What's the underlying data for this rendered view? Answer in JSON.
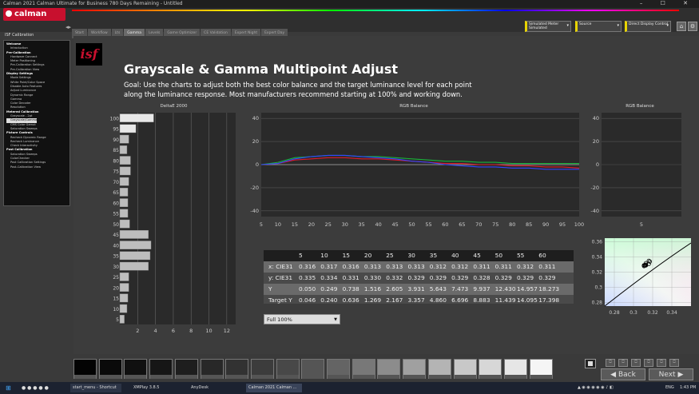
{
  "window": {
    "title": "Calman 2021 Calman Ultimate for Business 780 Days Remaining - Untitled",
    "controls": "–  ☐  ✕"
  },
  "app": {
    "logo": "calman"
  },
  "tabs": [
    "Start",
    "Workflow",
    "Lts",
    "Gamma",
    "Levels",
    "Game Optimizer",
    "CE Validation",
    "Expert Night",
    "Expert Day"
  ],
  "devices": [
    {
      "label": "Simulated Meter",
      "sub": "Simulated"
    },
    {
      "label": "Source",
      "sub": ""
    },
    {
      "label": "Direct Display Control",
      "sub": ""
    }
  ],
  "sidebar": {
    "heading": "ISF Calibration",
    "items": [
      {
        "t": "Welcome",
        "k": "sec"
      },
      {
        "t": "Introduction",
        "k": "it"
      },
      {
        "t": "Pre-Calibration",
        "k": "sec"
      },
      {
        "t": "Hardware Connect",
        "k": "it"
      },
      {
        "t": "Meter Positioning",
        "k": "it"
      },
      {
        "t": "Pre-Calibration Settings",
        "k": "it"
      },
      {
        "t": "Pre-Calibration View",
        "k": "it"
      },
      {
        "t": "Display Settings",
        "k": "sec"
      },
      {
        "t": "Mode Settings",
        "k": "it"
      },
      {
        "t": "White Point/Color Space",
        "k": "it"
      },
      {
        "t": "Disable Auto Features",
        "k": "it"
      },
      {
        "t": "Adjust Luminance",
        "k": "it"
      },
      {
        "t": "Dynamic Range",
        "k": "it"
      },
      {
        "t": "Gamma",
        "k": "it"
      },
      {
        "t": "Color Decoder",
        "k": "it"
      },
      {
        "t": "Resolution",
        "k": "it"
      },
      {
        "t": "Metered Calibration",
        "k": "sec"
      },
      {
        "t": "Grayscale - 2pt",
        "k": "it"
      },
      {
        "t": "Grayscale/Gamma",
        "k": "sel"
      },
      {
        "t": "CMS Color Gamut",
        "k": "it"
      },
      {
        "t": "Saturation Sweeps",
        "k": "it"
      },
      {
        "t": "Picture Controls",
        "k": "sec"
      },
      {
        "t": "Recheck Dynamic Range",
        "k": "it"
      },
      {
        "t": "Recheck Luminance",
        "k": "it"
      },
      {
        "t": "Check Interactivity",
        "k": "it"
      },
      {
        "t": "Post Calibration",
        "k": "sec"
      },
      {
        "t": "Saturation Sweeps",
        "k": "it"
      },
      {
        "t": "ColorChecker",
        "k": "it"
      },
      {
        "t": "Post Calibration Settings",
        "k": "it"
      },
      {
        "t": "Post-Calibration View",
        "k": "it"
      }
    ]
  },
  "page": {
    "logo_text": "isf",
    "title": "Grayscale &  Gamma Multipoint Adjust",
    "goal": "Goal: Use the charts to adjust both the best color balance and the target luminance level for each point along the luminance response. Most manufacturers recommend starting at 100% and working down."
  },
  "deltae": {
    "label": "DeltaE 2000",
    "y_ticks": [
      "100",
      "95",
      "90",
      "85",
      "80",
      "75",
      "70",
      "65",
      "60",
      "55",
      "50",
      "45",
      "40",
      "35",
      "30",
      "25",
      "20",
      "15",
      "10",
      "5"
    ],
    "x_ticks": [
      "2",
      "4",
      "6",
      "8",
      "10",
      "12"
    ],
    "values": [
      3.8,
      1.8,
      1.0,
      0.8,
      1.2,
      1.2,
      1.0,
      0.9,
      0.9,
      0.9,
      1.1,
      3.2,
      3.5,
      3.4,
      3.2,
      1.0,
      1.0,
      0.9,
      0.8,
      0.5
    ]
  },
  "rgb_balance": {
    "label": "RGB Balance",
    "y_ticks": [
      "40",
      "20",
      "0",
      "-20",
      "-40"
    ],
    "x_ticks": [
      "5",
      "10",
      "15",
      "20",
      "25",
      "30",
      "35",
      "40",
      "45",
      "50",
      "55",
      "60",
      "65",
      "70",
      "75",
      "80",
      "85",
      "90",
      "95",
      "100"
    ],
    "x": [
      5,
      10,
      15,
      20,
      25,
      30,
      35,
      40,
      45,
      50,
      55,
      60,
      65,
      70,
      75,
      80,
      85,
      90,
      95,
      100
    ],
    "red": [
      0,
      1,
      4,
      5,
      6,
      6,
      5,
      5,
      4,
      3,
      2,
      1,
      1,
      0,
      0,
      -1,
      -1,
      -2,
      -2,
      -3
    ],
    "green": [
      0,
      2,
      6,
      7,
      8,
      8,
      7,
      7,
      6,
      5,
      4,
      3,
      3,
      2,
      2,
      1,
      1,
      1,
      1,
      1
    ],
    "blue": [
      0,
      1,
      5,
      7,
      8,
      8,
      7,
      6,
      5,
      3,
      2,
      0,
      -1,
      -2,
      -2,
      -3,
      -3,
      -4,
      -4,
      -4
    ]
  },
  "rgb_balance2": {
    "label": "RGB Balance",
    "y_ticks": [
      "40",
      "20",
      "0",
      "-20",
      "-40"
    ],
    "x_ticks": [
      "5"
    ]
  },
  "cie": {
    "y_ticks": [
      "0.36",
      "0.34",
      "0.32",
      "0.3",
      "0.28"
    ],
    "x_ticks": [
      "0.28",
      "0.3",
      "0.32",
      "0.34"
    ]
  },
  "table": {
    "header": [
      "5",
      "10",
      "15",
      "20",
      "25",
      "30",
      "35",
      "40",
      "45",
      "50",
      "55",
      "60"
    ],
    "rows": [
      {
        "label": "x: CIE31",
        "values": [
          "0.316",
          "0.317",
          "0.316",
          "0.313",
          "0.313",
          "0.313",
          "0.312",
          "0.312",
          "0.311",
          "0.311",
          "0.312",
          "0.311"
        ]
      },
      {
        "label": "y: CIE31",
        "values": [
          "0.335",
          "0.334",
          "0.331",
          "0.330",
          "0.332",
          "0.329",
          "0.329",
          "0.329",
          "0.328",
          "0.329",
          "0.329",
          "0.329"
        ]
      },
      {
        "label": "Y",
        "values": [
          "0.050",
          "0.249",
          "0.738",
          "1.516",
          "2.605",
          "3.931",
          "5.643",
          "7.473",
          "9.937",
          "12.430",
          "14.957",
          "18.273"
        ]
      },
      {
        "label": "Target Y",
        "values": [
          "0.046",
          "0.240",
          "0.636",
          "1.269",
          "2.167",
          "3.357",
          "4.860",
          "6.696",
          "8.883",
          "11.439",
          "14.095",
          "17.398"
        ]
      }
    ]
  },
  "select": {
    "value": "Full  100%"
  },
  "swatches": [
    3,
    10,
    16,
    22,
    30,
    40,
    50,
    60,
    72,
    85,
    100,
    120,
    140,
    160,
    180,
    200,
    215,
    230,
    245
  ],
  "nav": {
    "back": "Back",
    "next": "Next"
  },
  "taskbar": {
    "items": [
      "start_menu - Shortcut",
      "XMPlay 3.8.5",
      "AnyDesk",
      "Calman 2021 Calman ..."
    ],
    "lang": "ENG",
    "time": "1:43 PM"
  }
}
